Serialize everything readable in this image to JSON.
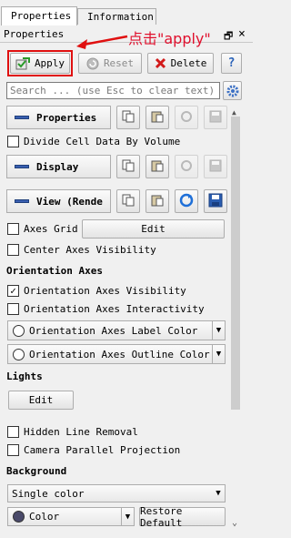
{
  "tabs": [
    {
      "label": "Properties",
      "active": true
    },
    {
      "label": "Information",
      "active": false
    }
  ],
  "panel_title": "Properties",
  "title_controls": {
    "float": "🗗",
    "close": "×"
  },
  "toolbar": {
    "apply_label": "Apply",
    "reset_label": "Reset",
    "delete_label": "Delete",
    "help_label": "?"
  },
  "annotation": "点击\"apply\"",
  "search": {
    "placeholder": "Search ... (use Esc to clear text)"
  },
  "sections": {
    "properties_label": "Properties",
    "display_label": "Display",
    "view_label": "View (Rende"
  },
  "checkboxes": {
    "divide_cell": {
      "label": "Divide Cell Data By Volume",
      "checked": false
    },
    "axes_grid": {
      "label": "Axes Grid",
      "checked": false
    },
    "center_axes": {
      "label": "Center Axes Visibility",
      "checked": false
    },
    "orient_vis": {
      "label": "Orientation Axes Visibility",
      "checked": true
    },
    "orient_inter": {
      "label": "Orientation Axes Interactivity",
      "checked": false
    },
    "hidden_line": {
      "label": "Hidden Line Removal",
      "checked": false
    },
    "camera_parallel": {
      "label": "Camera Parallel Projection",
      "checked": false
    }
  },
  "edit_label": "Edit",
  "headings": {
    "orientation_axes": "Orientation Axes",
    "lights": "Lights",
    "background": "Background"
  },
  "color_combos": {
    "label_color": "Orientation Axes Label Color",
    "outline_color": "Orientation Axes Outline Color"
  },
  "background_select": "Single color",
  "color_select": "Color",
  "restore_default_label": "Restore Default",
  "colors": {
    "accent_red": "#e01010",
    "highlight_blue": "#1e6fd8"
  }
}
